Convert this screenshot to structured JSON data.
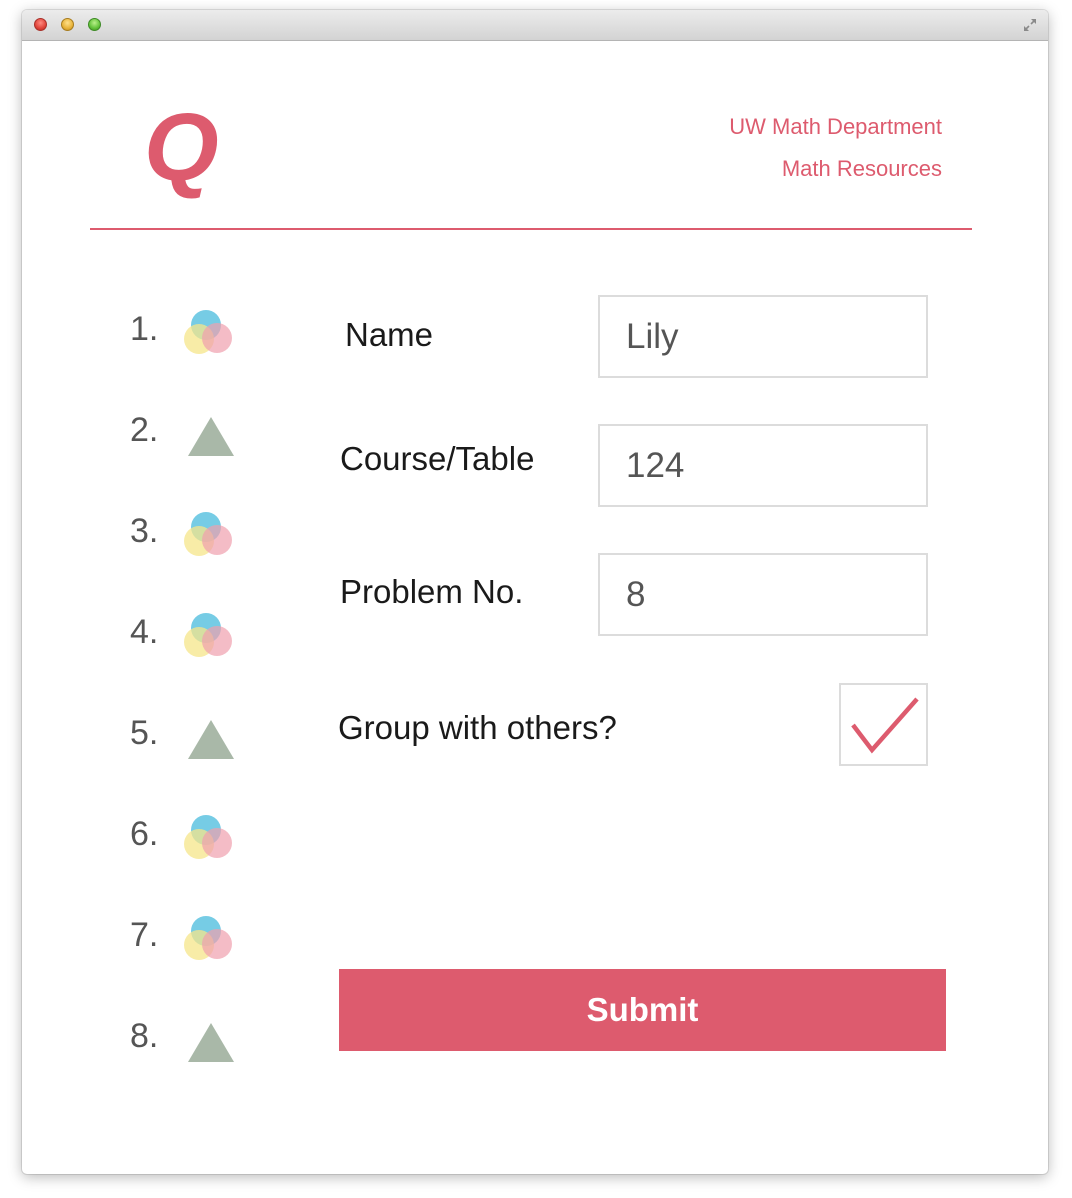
{
  "window": {
    "controls": [
      "close-icon",
      "minimize-icon",
      "zoom-icon"
    ],
    "fullscreen_icon": "fullscreen-arrows-icon"
  },
  "header": {
    "logo": "Q",
    "links": [
      "UW Math Department",
      "Math Resources"
    ]
  },
  "queue": [
    {
      "number": "1.",
      "icon": "venn-circles-icon"
    },
    {
      "number": "2.",
      "icon": "triangle-icon"
    },
    {
      "number": "3.",
      "icon": "venn-circles-icon"
    },
    {
      "number": "4.",
      "icon": "venn-circles-icon"
    },
    {
      "number": "5.",
      "icon": "triangle-icon"
    },
    {
      "number": "6.",
      "icon": "venn-circles-icon"
    },
    {
      "number": "7.",
      "icon": "venn-circles-icon"
    },
    {
      "number": "8.",
      "icon": "triangle-icon"
    }
  ],
  "form": {
    "name_label": "Name",
    "name_value": "Lily",
    "course_label": "Course/Table",
    "course_value": "124",
    "problem_label": "Problem No.",
    "problem_value": "8",
    "group_label": "Group with others?",
    "group_checked": true,
    "submit_label": "Submit"
  },
  "colors": {
    "accent": "#dd5b6e",
    "triangle": "#a9b8a8",
    "venn_blue": "#5ec3e0",
    "venn_yellow": "#f5e58a",
    "venn_pink": "#f0a0ae"
  }
}
